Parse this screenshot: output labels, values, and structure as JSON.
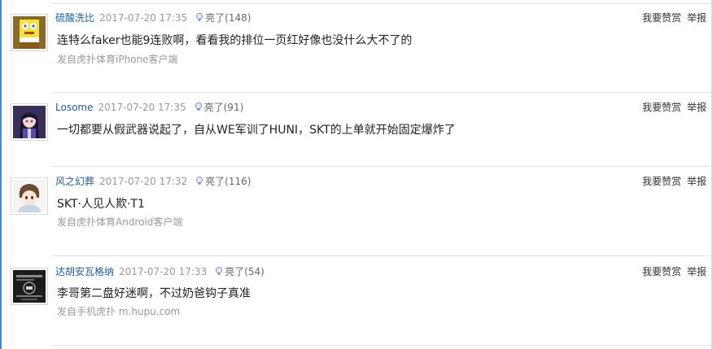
{
  "colors": {
    "username": "#1a5fa8",
    "meta": "#999999",
    "content": "#222222",
    "divider": "#e1e1e1"
  },
  "replies": [
    {
      "avatar_icon": "spongebob-avatar-icon",
      "username": "硫酸洗比",
      "time": "2017-07-20 17:35",
      "light_label": "亮了(148)",
      "reward_label": "我要赞赏",
      "report_label": "举报",
      "content": "连特么faker也能9连败啊，看看我的排位一页红好像也没什么大不了的",
      "source": "发自虎扑体育iPhone客户端"
    },
    {
      "avatar_icon": "anime-girl-avatar-icon",
      "username": "Losome",
      "time": "2017-07-20 17:35",
      "light_label": "亮了(91)",
      "reward_label": "我要赞赏",
      "report_label": "举报",
      "content": "一切都要从假武器说起了，自从WE军训了HUNI，SKT的上单就开始固定爆炸了",
      "source": ""
    },
    {
      "avatar_icon": "anime-boy-avatar-icon",
      "username": "风之幻葬",
      "time": "2017-07-20 17:32",
      "light_label": "亮了(116)",
      "reward_label": "我要赞赏",
      "report_label": "举报",
      "content": "SKT·人见人欺·T1",
      "source": "发自虎扑体育Android客户端"
    },
    {
      "avatar_icon": "dark-badge-avatar-icon",
      "username": "达胡安瓦格纳",
      "time": "2017-07-20 17:33",
      "light_label": "亮了(54)",
      "reward_label": "我要赞赏",
      "report_label": "举报",
      "content": "李哥第二盘好迷啊，不过奶爸钩子真准",
      "source": "发自手机虎扑 m.hupu.com"
    }
  ]
}
